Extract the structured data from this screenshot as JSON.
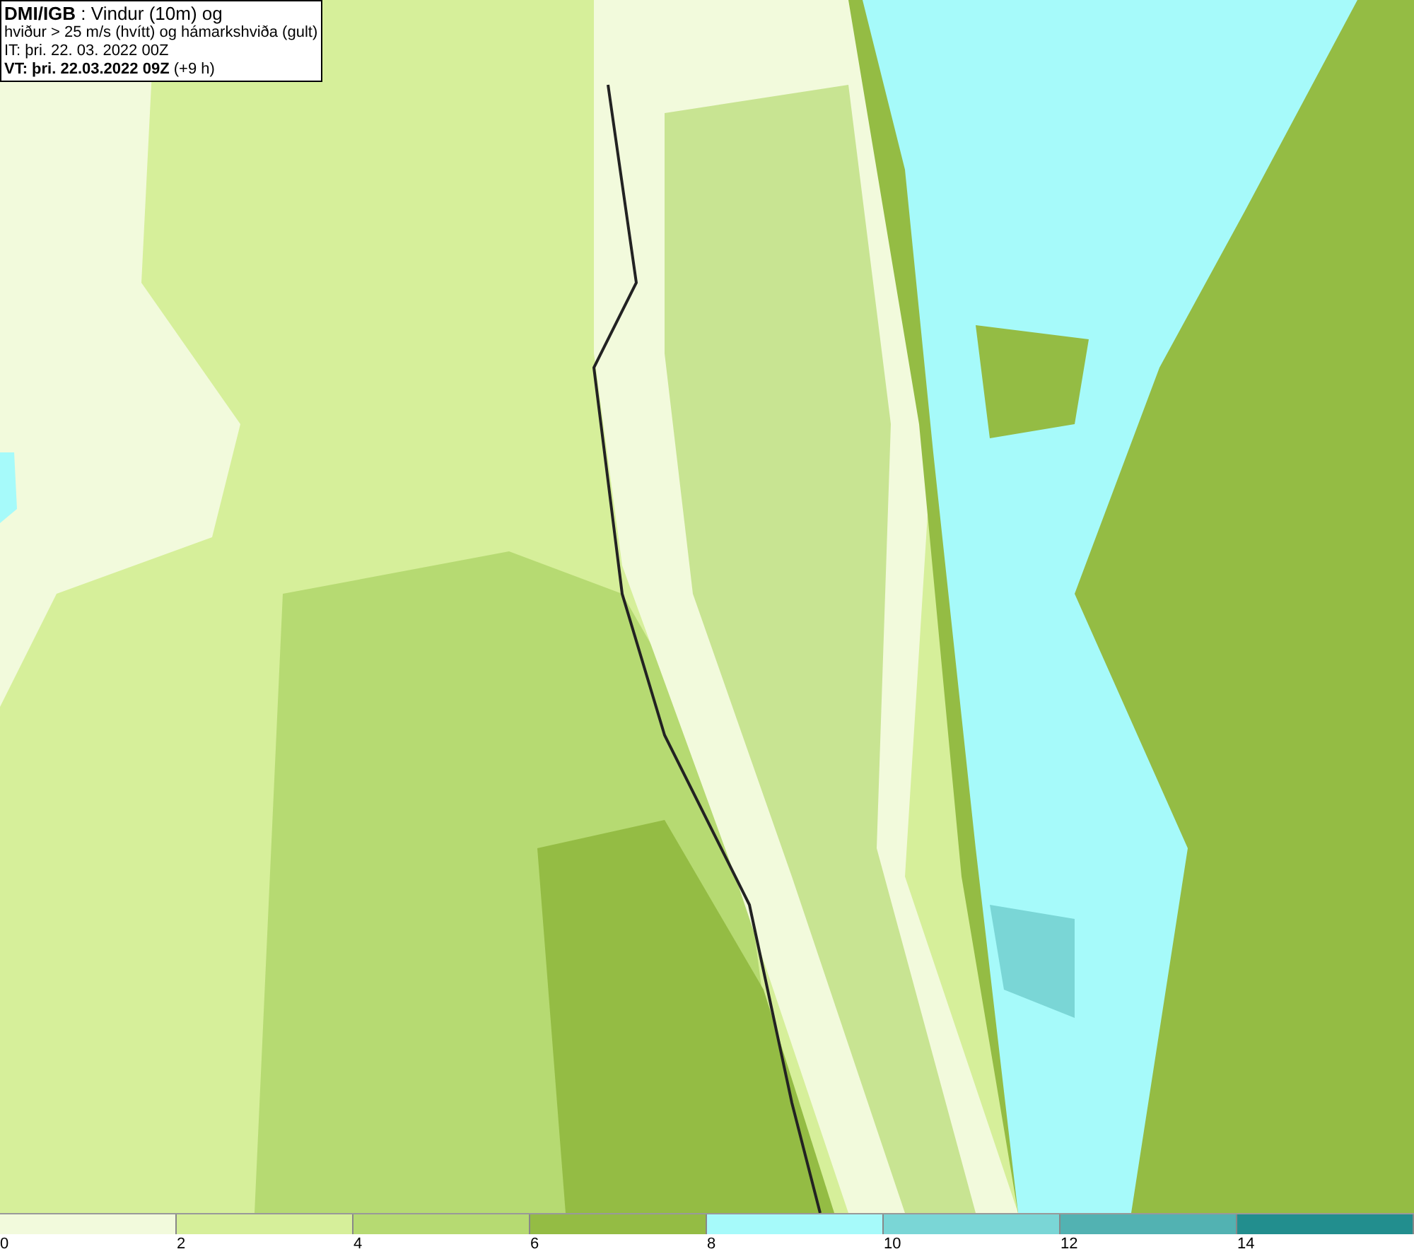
{
  "title_box": {
    "lines": [
      "**DMI/IGB** : Vindur (10m) og",
      "hviður > 25 m/s (hvítt) og hámarkshviða (gult)",
      "IT: þri. 22. 03. 2022 00Z",
      "**VT: þri. 22.03.2022 09Z** (+9 h)"
    ]
  },
  "legend": [
    {
      "label": "0",
      "color": "#f2fadc"
    },
    {
      "label": "2",
      "color": "#d6ef9a"
    },
    {
      "label": "4",
      "color": "#b6da72"
    },
    {
      "label": "6",
      "color": "#94bc44"
    },
    {
      "label": "8",
      "color": "#a6fafa"
    },
    {
      "label": "10",
      "color": "#7ad6d6"
    },
    {
      "label": "12",
      "color": "#52b2b2"
    },
    {
      "label": "14",
      "color": "#228e8e"
    }
  ]
}
